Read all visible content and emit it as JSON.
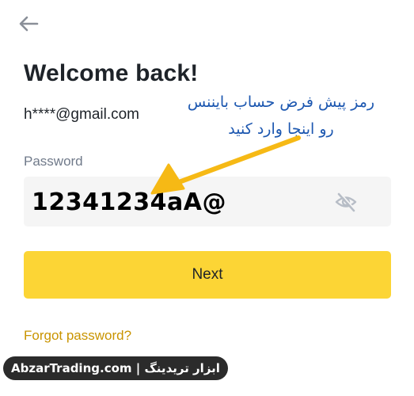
{
  "header": {
    "back_icon": "arrow-left-icon"
  },
  "login": {
    "title": "Welcome back!",
    "email": "h****@gmail.com",
    "password_label": "Password",
    "password_value": "12341234aA@",
    "visibility_icon": "eye-off-icon",
    "next_label": "Next",
    "forgot_label": "Forgot password?"
  },
  "annotation": {
    "line1": "رمز پیش فرض حساب بایننس",
    "line2": "رو اینجا وارد کنید",
    "color": "#1c57b0",
    "arrow_color": "#f6b915"
  },
  "watermark": {
    "text": "AbzarTrading.com | ابزار تریدینگ"
  },
  "colors": {
    "primary_button": "#fcd535",
    "link": "#c99400",
    "text": "#1e2329",
    "muted": "#707a8a",
    "input_bg": "#f5f5f5"
  }
}
